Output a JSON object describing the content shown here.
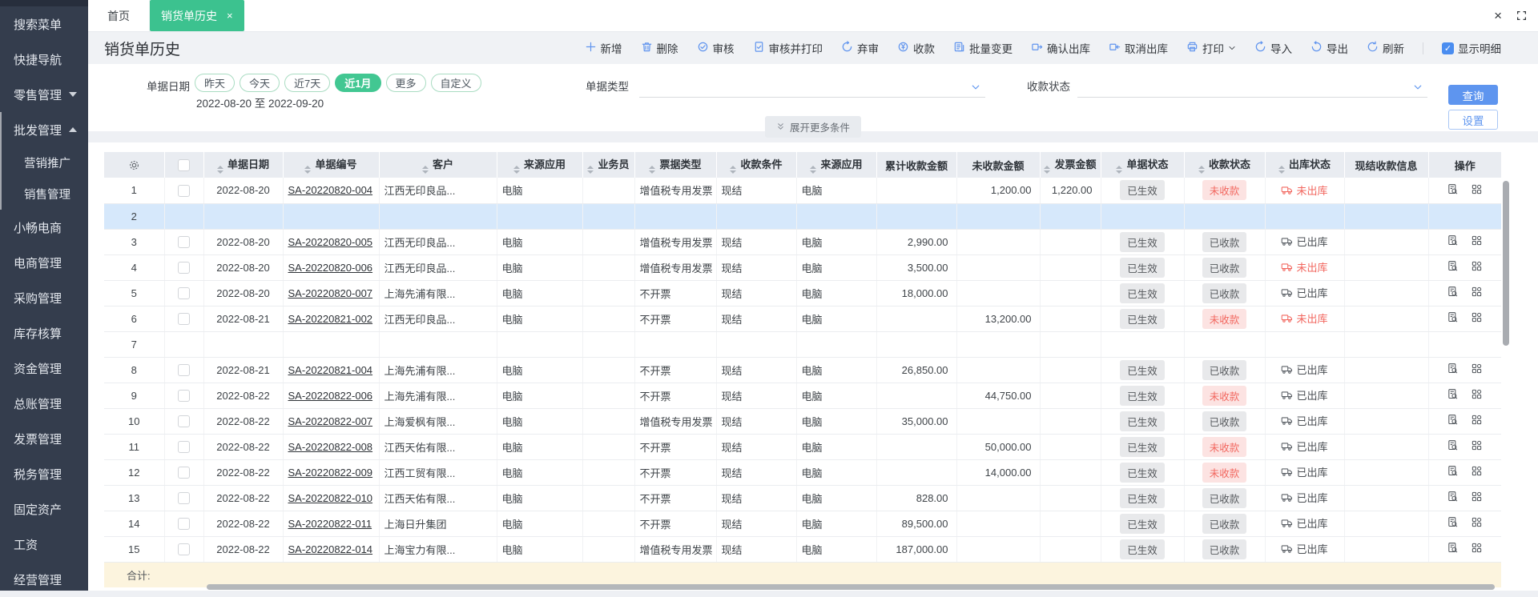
{
  "colors": {
    "accent_green": "#3cc28f",
    "accent_blue": "#5e95ef",
    "danger_red": "#f2675f",
    "selected_row_bg": "#d6e8fb",
    "total_row_bg": "#fcf4de",
    "sidebar_bg": "#343d4d",
    "header_row_bg": "#e9ecf1"
  },
  "sidebar": {
    "items": [
      {
        "label": "搜索菜单",
        "type": "item"
      },
      {
        "label": "快捷导航",
        "type": "item"
      },
      {
        "label": "零售管理",
        "type": "group-collapsed"
      },
      {
        "label": "批发管理",
        "type": "group-expanded",
        "in_group": true
      },
      {
        "label": "营销推广",
        "type": "sub",
        "in_group": true
      },
      {
        "label": "销售管理",
        "type": "sub",
        "in_group": true
      },
      {
        "label": "小畅电商",
        "type": "item"
      },
      {
        "label": "电商管理",
        "type": "item"
      },
      {
        "label": "采购管理",
        "type": "item"
      },
      {
        "label": "库存核算",
        "type": "item"
      },
      {
        "label": "资金管理",
        "type": "item"
      },
      {
        "label": "总账管理",
        "type": "item"
      },
      {
        "label": "发票管理",
        "type": "item"
      },
      {
        "label": "税务管理",
        "type": "item"
      },
      {
        "label": "固定资产",
        "type": "item"
      },
      {
        "label": "工资",
        "type": "item"
      },
      {
        "label": "经营管理",
        "type": "item"
      }
    ]
  },
  "tabs": {
    "home": "首页",
    "current": "销货单历史",
    "close_glyph": "×"
  },
  "window": {
    "close_glyph": "×"
  },
  "page": {
    "title": "销货单历史"
  },
  "toolbar": {
    "buttons": [
      {
        "label": "新增",
        "icon": "plus-icon"
      },
      {
        "label": "删除",
        "icon": "trash-icon"
      },
      {
        "label": "审核",
        "icon": "audit-icon"
      },
      {
        "label": "审核并打印",
        "icon": "audit-print-icon"
      },
      {
        "label": "弃审",
        "icon": "abandon-audit-icon"
      },
      {
        "label": "收款",
        "icon": "collect-payment-icon"
      },
      {
        "label": "批量变更",
        "icon": "batch-change-icon"
      },
      {
        "label": "确认出库",
        "icon": "confirm-outbound-icon"
      },
      {
        "label": "取消出库",
        "icon": "cancel-outbound-icon"
      },
      {
        "label": "打印",
        "icon": "print-icon",
        "dropdown": true
      },
      {
        "label": "导入",
        "icon": "import-icon"
      },
      {
        "label": "导出",
        "icon": "export-icon"
      },
      {
        "label": "刷新",
        "icon": "refresh-icon"
      }
    ],
    "show_detail": {
      "label": "显示明细",
      "checked": true
    }
  },
  "filters": {
    "date_label": "单据日期",
    "date_pills": [
      {
        "label": "昨天",
        "active": false
      },
      {
        "label": "今天",
        "active": false
      },
      {
        "label": "近7天",
        "active": false
      },
      {
        "label": "近1月",
        "active": true
      },
      {
        "label": "更多",
        "active": false
      },
      {
        "label": "自定义",
        "active": false
      }
    ],
    "date_range": "2022-08-20 至 2022-09-20",
    "doc_type_label": "单据类型",
    "doc_type_value": "",
    "pay_status_label": "收款状态",
    "pay_status_value": "",
    "query_button": "查询",
    "settings_button": "设置",
    "expand_more": "展开更多条件"
  },
  "table": {
    "columns": [
      {
        "label": "",
        "icon": "gear-icon"
      },
      {
        "label": "",
        "checkbox": true
      },
      {
        "label": "单据日期",
        "sortable": true
      },
      {
        "label": "单据编号",
        "sortable": true
      },
      {
        "label": "客户",
        "sortable": true
      },
      {
        "label": "来源应用",
        "sortable": true
      },
      {
        "label": "业务员",
        "sortable": true
      },
      {
        "label": "票据类型",
        "sortable": true
      },
      {
        "label": "收款条件",
        "sortable": true
      },
      {
        "label": "来源应用",
        "sortable": true
      },
      {
        "label": "累计收款金额",
        "sortable": false
      },
      {
        "label": "未收款金额",
        "sortable": false
      },
      {
        "label": "发票金额",
        "sortable": true
      },
      {
        "label": "单据状态",
        "sortable": true
      },
      {
        "label": "收款状态",
        "sortable": true
      },
      {
        "label": "出库状态",
        "sortable": true
      },
      {
        "label": "现结收款信息",
        "sortable": false
      },
      {
        "label": "操作",
        "sortable": false
      }
    ],
    "rows": [
      {
        "num": "1",
        "date": "2022-08-20",
        "no": "SA-20220820-004",
        "customer": "江西无印良品...",
        "source": "电脑",
        "salesman": "",
        "invoice_type": "增值税专用发票",
        "pay_condition": "现结",
        "source2": "电脑",
        "received_total": "",
        "unreceived": "1,200.00",
        "invoice_amount": "1,220.00",
        "doc_status": "已生效",
        "pay_status": "未收款",
        "pay_status_state": "unpaid",
        "out_status": "未出库",
        "out_status_state": "not-out",
        "cash_info": ""
      },
      {
        "num": "2",
        "empty": true,
        "selected": true
      },
      {
        "num": "3",
        "date": "2022-08-20",
        "no": "SA-20220820-005",
        "customer": "江西无印良品...",
        "source": "电脑",
        "salesman": "",
        "invoice_type": "增值税专用发票",
        "pay_condition": "现结",
        "source2": "电脑",
        "received_total": "2,990.00",
        "unreceived": "",
        "invoice_amount": "",
        "doc_status": "已生效",
        "pay_status": "已收款",
        "pay_status_state": "paid",
        "out_status": "已出库",
        "out_status_state": "out",
        "cash_info": ""
      },
      {
        "num": "4",
        "date": "2022-08-20",
        "no": "SA-20220820-006",
        "customer": "江西无印良品...",
        "source": "电脑",
        "salesman": "",
        "invoice_type": "增值税专用发票",
        "pay_condition": "现结",
        "source2": "电脑",
        "received_total": "3,500.00",
        "unreceived": "",
        "invoice_amount": "",
        "doc_status": "已生效",
        "pay_status": "已收款",
        "pay_status_state": "paid",
        "out_status": "未出库",
        "out_status_state": "not-out",
        "cash_info": ""
      },
      {
        "num": "5",
        "date": "2022-08-20",
        "no": "SA-20220820-007",
        "customer": "上海先浦有限...",
        "source": "电脑",
        "salesman": "",
        "invoice_type": "不开票",
        "pay_condition": "现结",
        "source2": "电脑",
        "received_total": "18,000.00",
        "unreceived": "",
        "invoice_amount": "",
        "doc_status": "已生效",
        "pay_status": "已收款",
        "pay_status_state": "paid",
        "out_status": "已出库",
        "out_status_state": "out",
        "cash_info": ""
      },
      {
        "num": "6",
        "date": "2022-08-21",
        "no": "SA-20220821-002",
        "customer": "江西无印良品...",
        "source": "电脑",
        "salesman": "",
        "invoice_type": "不开票",
        "pay_condition": "现结",
        "source2": "电脑",
        "received_total": "",
        "unreceived": "13,200.00",
        "invoice_amount": "",
        "doc_status": "已生效",
        "pay_status": "未收款",
        "pay_status_state": "unpaid",
        "out_status": "未出库",
        "out_status_state": "not-out",
        "cash_info": ""
      },
      {
        "num": "7",
        "empty": true
      },
      {
        "num": "8",
        "date": "2022-08-21",
        "no": "SA-20220821-004",
        "customer": "上海先浦有限...",
        "source": "电脑",
        "salesman": "",
        "invoice_type": "不开票",
        "pay_condition": "现结",
        "source2": "电脑",
        "received_total": "26,850.00",
        "unreceived": "",
        "invoice_amount": "",
        "doc_status": "已生效",
        "pay_status": "已收款",
        "pay_status_state": "paid",
        "out_status": "已出库",
        "out_status_state": "out",
        "cash_info": ""
      },
      {
        "num": "9",
        "date": "2022-08-22",
        "no": "SA-20220822-006",
        "customer": "上海先浦有限...",
        "source": "电脑",
        "salesman": "",
        "invoice_type": "不开票",
        "pay_condition": "现结",
        "source2": "电脑",
        "received_total": "",
        "unreceived": "44,750.00",
        "invoice_amount": "",
        "doc_status": "已生效",
        "pay_status": "未收款",
        "pay_status_state": "unpaid",
        "out_status": "已出库",
        "out_status_state": "out",
        "cash_info": ""
      },
      {
        "num": "10",
        "date": "2022-08-22",
        "no": "SA-20220822-007",
        "customer": "上海爱枫有限...",
        "source": "电脑",
        "salesman": "",
        "invoice_type": "增值税专用发票",
        "pay_condition": "现结",
        "source2": "电脑",
        "received_total": "35,000.00",
        "unreceived": "",
        "invoice_amount": "",
        "doc_status": "已生效",
        "pay_status": "已收款",
        "pay_status_state": "paid",
        "out_status": "已出库",
        "out_status_state": "out",
        "cash_info": ""
      },
      {
        "num": "11",
        "date": "2022-08-22",
        "no": "SA-20220822-008",
        "customer": "江西天佑有限...",
        "source": "电脑",
        "salesman": "",
        "invoice_type": "不开票",
        "pay_condition": "现结",
        "source2": "电脑",
        "received_total": "",
        "unreceived": "50,000.00",
        "invoice_amount": "",
        "doc_status": "已生效",
        "pay_status": "未收款",
        "pay_status_state": "unpaid",
        "out_status": "已出库",
        "out_status_state": "out",
        "cash_info": ""
      },
      {
        "num": "12",
        "date": "2022-08-22",
        "no": "SA-20220822-009",
        "customer": "江西工贸有限...",
        "source": "电脑",
        "salesman": "",
        "invoice_type": "不开票",
        "pay_condition": "现结",
        "source2": "电脑",
        "received_total": "",
        "unreceived": "14,000.00",
        "invoice_amount": "",
        "doc_status": "已生效",
        "pay_status": "未收款",
        "pay_status_state": "unpaid",
        "out_status": "已出库",
        "out_status_state": "out",
        "cash_info": ""
      },
      {
        "num": "13",
        "date": "2022-08-22",
        "no": "SA-20220822-010",
        "customer": "江西天佑有限...",
        "source": "电脑",
        "salesman": "",
        "invoice_type": "不开票",
        "pay_condition": "现结",
        "source2": "电脑",
        "received_total": "828.00",
        "unreceived": "",
        "invoice_amount": "",
        "doc_status": "已生效",
        "pay_status": "已收款",
        "pay_status_state": "paid",
        "out_status": "已出库",
        "out_status_state": "out",
        "cash_info": ""
      },
      {
        "num": "14",
        "date": "2022-08-22",
        "no": "SA-20220822-011",
        "customer": "上海日升集团",
        "source": "电脑",
        "salesman": "",
        "invoice_type": "不开票",
        "pay_condition": "现结",
        "source2": "电脑",
        "received_total": "89,500.00",
        "unreceived": "",
        "invoice_amount": "",
        "doc_status": "已生效",
        "pay_status": "已收款",
        "pay_status_state": "paid",
        "out_status": "已出库",
        "out_status_state": "out",
        "cash_info": ""
      },
      {
        "num": "15",
        "date": "2022-08-22",
        "no": "SA-20220822-014",
        "customer": "上海宝力有限...",
        "source": "电脑",
        "salesman": "",
        "invoice_type": "增值税专用发票",
        "pay_condition": "现结",
        "source2": "电脑",
        "received_total": "187,000.00",
        "unreceived": "",
        "invoice_amount": "",
        "doc_status": "已生效",
        "pay_status": "已收款",
        "pay_status_state": "paid",
        "out_status": "已出库",
        "out_status_state": "out",
        "cash_info": ""
      }
    ],
    "footer": {
      "label": "合计:"
    }
  }
}
